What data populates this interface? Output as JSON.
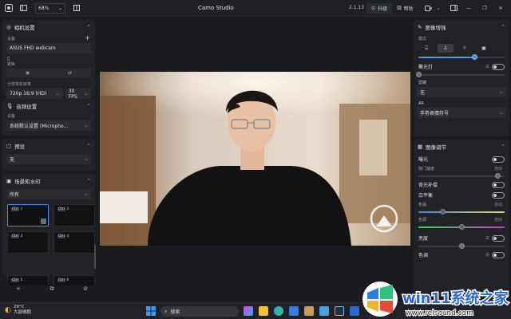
{
  "titlebar": {
    "zoom": "68%",
    "app_title": "Camo Studio",
    "version": "2.1.13",
    "upgrade_label": "升级",
    "help_label": "帮助"
  },
  "left_panel": {
    "camera": {
      "title": "相机设置",
      "device_label": "设备",
      "device_value": "ASUS FHD webcam",
      "focus_label": "聚焦",
      "resolution_label": "分辨率和帧率",
      "resolution_value": "720p 16:9 (HD)",
      "fps_value": "30 FPS"
    },
    "audio": {
      "title": "音频设置",
      "device_label": "设备",
      "device_value": "系统默认设置 (Micropho..."
    },
    "presets": {
      "title": "预设",
      "value": "无"
    },
    "scenes": {
      "title": "场景和水印",
      "filter_value": "所有",
      "thumbs": [
        {
          "key": "Ctrl",
          "num": "1"
        },
        {
          "key": "Ctrl",
          "num": "2"
        },
        {
          "key": "Ctrl",
          "num": "3"
        },
        {
          "key": "Ctrl",
          "num": "4"
        },
        {
          "key": "Ctrl",
          "num": "5"
        },
        {
          "key": "Ctrl",
          "num": "6"
        }
      ]
    }
  },
  "right_panel": {
    "enhance": {
      "title": "图像增强",
      "mode_label": "模式",
      "mode_slider_value": 0.65,
      "fill_light_label": "聚光灯",
      "fill_light_state": "关",
      "blur_label": "滤镜",
      "blur_value": "无",
      "ar_label": "AR",
      "ar_value": "手势表情符号"
    },
    "adjust": {
      "title": "图像调节",
      "exposure_label": "曝光",
      "shutter_label": "快门速度",
      "shutter_state": "自动",
      "shutter_value": 0.92,
      "backlight_label": "背光补偿",
      "wb_label": "白平衡",
      "wb_state": "自动",
      "tint_label": "色温",
      "tint_value": 0.28,
      "hue_label": "色调",
      "hue_state": "自动",
      "hue_value": 0.5,
      "brightness_label": "亮度",
      "brightness_state": "关",
      "brightness_value": 0.5,
      "saturation_label": "色调",
      "saturation_state": "关"
    }
  },
  "taskbar": {
    "weather_temp": "29°C",
    "weather_text": "大部晴朗",
    "search_placeholder": "搜索"
  },
  "watermark_brand": {
    "name": "win11系统之家",
    "url": "www.relsound.com"
  },
  "colors": {
    "accent": "#4a8fe8",
    "panel_bg": "#202226",
    "window_bg": "#191b1f"
  }
}
